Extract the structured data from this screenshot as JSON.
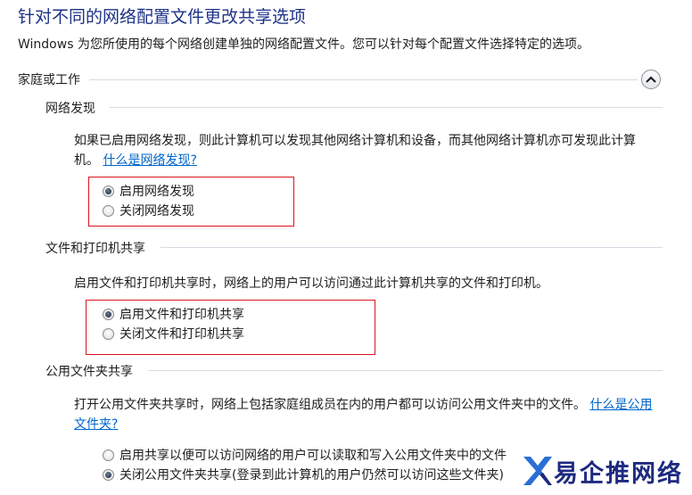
{
  "page": {
    "title": "针对不同的网络配置文件更改共享选项",
    "subtitle": "Windows 为您所使用的每个网络创建单独的网络配置文件。您可以针对每个配置文件选择特定的选项。"
  },
  "section": {
    "label": "家庭或工作",
    "collapse_icon": "chevron-up-icon"
  },
  "network_discovery": {
    "title": "网络发现",
    "description": "如果已启用网络发现，则此计算机可以发现其他网络计算机和设备，而其他网络计算机亦可发现此计算机。",
    "link": "什么是网络发现?",
    "options": [
      {
        "label": "启用网络发现",
        "checked": true
      },
      {
        "label": "关闭网络发现",
        "checked": false
      }
    ]
  },
  "file_printer_sharing": {
    "title": "文件和打印机共享",
    "description": "启用文件和打印机共享时，网络上的用户可以访问通过此计算机共享的文件和打印机。",
    "options": [
      {
        "label": "启用文件和打印机共享",
        "checked": true
      },
      {
        "label": "关闭文件和打印机共享",
        "checked": false
      }
    ]
  },
  "public_folder_sharing": {
    "title": "公用文件夹共享",
    "description": "打开公用文件夹共享时，网络上包括家庭组成员在内的用户都可以访问公用文件夹中的文件。",
    "link": "什么是公用文件夹?",
    "options": [
      {
        "label": "启用共享以便可以访问网络的用户可以读取和写入公用文件夹中的文件",
        "checked": false
      },
      {
        "label": "关闭公用文件夹共享(登录到此计算机的用户仍然可以访问这些文件夹)",
        "checked": true
      }
    ]
  },
  "watermark": {
    "text": "易企推网络",
    "icon": "x-logo-icon"
  },
  "colors": {
    "title": "#1e3287",
    "link": "#0066cc",
    "highlight_box": "#d9141e"
  }
}
